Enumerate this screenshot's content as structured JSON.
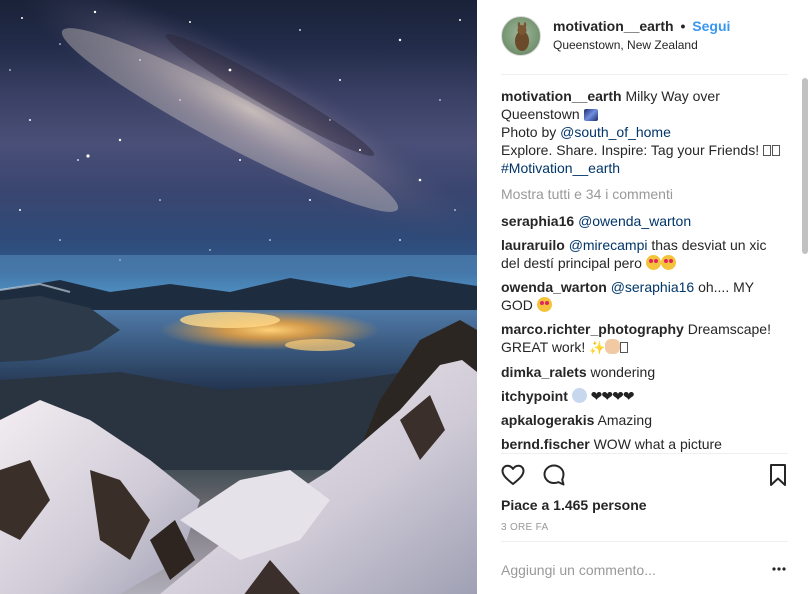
{
  "post": {
    "username": "motivation__earth",
    "separator": "•",
    "follow_label": "Segui",
    "location": "Queenstown, New Zealand"
  },
  "caption": {
    "username": "motivation__earth",
    "line1": "Milky Way over Queenstown",
    "photo_by_prefix": "Photo by ",
    "photo_by_mention": "@south_of_home",
    "line3": "Explore. Share. Inspire: Tag your Friends!",
    "hashtag": "#Motivation__earth"
  },
  "view_all_comments": "Mostra tutti e 34 i commenti",
  "comments": [
    {
      "user": "seraphia16",
      "mention": "@owenda_warton",
      "text": ""
    },
    {
      "user": "lauraruilo",
      "mention": "@mirecampi",
      "text": " thas desviat un xic del destí principal pero"
    },
    {
      "user": "owenda_warton",
      "mention": "@seraphia16",
      "text": " oh.... MY GOD"
    },
    {
      "user": "marco.richter_photography",
      "mention": "",
      "text": "Dreamscape! GREAT work!"
    },
    {
      "user": "dimka_ralets",
      "mention": "",
      "text": "wondering"
    },
    {
      "user": "itchypoint",
      "mention": "",
      "text": "❤❤❤❤"
    },
    {
      "user": "apkalogerakis",
      "mention": "",
      "text": "Amazing"
    },
    {
      "user": "bernd.fischer",
      "mention": "",
      "text": "WOW what a picture"
    }
  ],
  "likes_text": "Piace a 1.465 persone",
  "time_ago": "3 ORE FA",
  "comment_input": {
    "placeholder": "Aggiungi un commento...",
    "value": ""
  },
  "icons": {
    "like": "heart-outline-icon",
    "comment": "comment-bubble-icon",
    "save": "bookmark-outline-icon",
    "more": "more-horizontal-icon"
  },
  "colors": {
    "link_blue": "#3897f0",
    "mention_blue": "#003569",
    "muted": "#999999",
    "text": "#262626"
  }
}
